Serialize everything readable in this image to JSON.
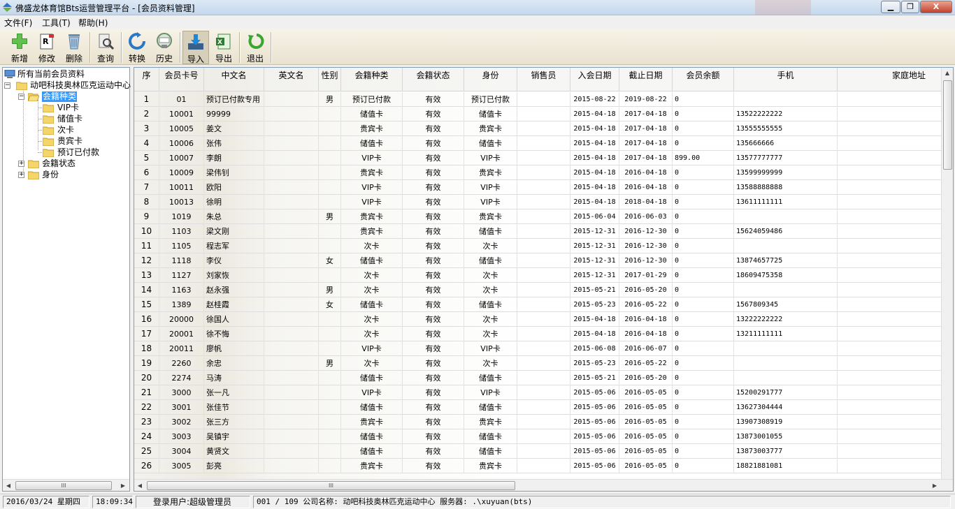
{
  "window": {
    "title": "佛盛龙体育馆Bts运营管理平台 - [会员资料管理]",
    "minimize": "▁",
    "restore": "❐",
    "close": "X"
  },
  "menu": [
    "文件(F)",
    "工具(T)",
    "帮助(H)"
  ],
  "toolbar": [
    {
      "label": "新增",
      "icon": "add-icon"
    },
    {
      "label": "修改",
      "icon": "edit-icon"
    },
    {
      "label": "删除",
      "icon": "delete-icon"
    },
    {
      "label": "查询",
      "icon": "search-icon"
    },
    {
      "label": "转换",
      "icon": "convert-icon"
    },
    {
      "label": "历史",
      "icon": "history-icon"
    },
    {
      "label": "导入",
      "icon": "import-icon"
    },
    {
      "label": "导出",
      "icon": "export-icon"
    },
    {
      "label": "退出",
      "icon": "exit-icon"
    }
  ],
  "tree": {
    "root": "所有当前会员资料",
    "company": "动吧科技奥林匹克运动中心",
    "category": "会籍种类",
    "cards": [
      "VIP卡",
      "储值卡",
      "次卡",
      "贵宾卡",
      "预订已付款"
    ],
    "status": "会籍状态",
    "identity": "身份"
  },
  "columns": [
    "序",
    "会员卡号",
    "中文名",
    "英文名",
    "性别",
    "会籍种类",
    "会籍状态",
    "身份",
    "销售员",
    "入会日期",
    "截止日期",
    "会员余额",
    "手机",
    "家庭地址"
  ],
  "rows": [
    [
      "1",
      "01",
      "预订已付款专用",
      "",
      "男",
      "预订已付款",
      "有效",
      "预订已付款",
      "",
      "2015-08-22",
      "2019-08-22",
      "0",
      ""
    ],
    [
      "2",
      "10001",
      "99999",
      "",
      "",
      "储值卡",
      "有效",
      "储值卡",
      "",
      "2015-04-18",
      "2017-04-18",
      "0",
      "13522222222"
    ],
    [
      "3",
      "10005",
      "姜文",
      "",
      "",
      "贵宾卡",
      "有效",
      "贵宾卡",
      "",
      "2015-04-18",
      "2017-04-18",
      "0",
      "13555555555"
    ],
    [
      "4",
      "10006",
      "张伟",
      "",
      "",
      "储值卡",
      "有效",
      "储值卡",
      "",
      "2015-04-18",
      "2017-04-18",
      "0",
      "135666666"
    ],
    [
      "5",
      "10007",
      "李朗",
      "",
      "",
      "VIP卡",
      "有效",
      "VIP卡",
      "",
      "2015-04-18",
      "2017-04-18",
      "899.00",
      "13577777777"
    ],
    [
      "6",
      "10009",
      "梁伟钊",
      "",
      "",
      "贵宾卡",
      "有效",
      "贵宾卡",
      "",
      "2015-04-18",
      "2016-04-18",
      "0",
      "13599999999"
    ],
    [
      "7",
      "10011",
      "欧阳",
      "",
      "",
      "VIP卡",
      "有效",
      "VIP卡",
      "",
      "2015-04-18",
      "2016-04-18",
      "0",
      "13588888888"
    ],
    [
      "8",
      "10013",
      "徐明",
      "",
      "",
      "VIP卡",
      "有效",
      "VIP卡",
      "",
      "2015-04-18",
      "2018-04-18",
      "0",
      "13611111111"
    ],
    [
      "9",
      "1019",
      "朱总",
      "",
      "男",
      "贵宾卡",
      "有效",
      "贵宾卡",
      "",
      "2015-06-04",
      "2016-06-03",
      "0",
      ""
    ],
    [
      "10",
      "1103",
      "梁文刚",
      "",
      "",
      "贵宾卡",
      "有效",
      "储值卡",
      "",
      "2015-12-31",
      "2016-12-30",
      "0",
      "15624059486"
    ],
    [
      "11",
      "1105",
      "程志军",
      "",
      "",
      "次卡",
      "有效",
      "次卡",
      "",
      "2015-12-31",
      "2016-12-30",
      "0",
      ""
    ],
    [
      "12",
      "1118",
      "李仪",
      "",
      "女",
      "储值卡",
      "有效",
      "储值卡",
      "",
      "2015-12-31",
      "2016-12-30",
      "0",
      "13874657725"
    ],
    [
      "13",
      "1127",
      "刘家恢",
      "",
      "",
      "次卡",
      "有效",
      "次卡",
      "",
      "2015-12-31",
      "2017-01-29",
      "0",
      "18609475358"
    ],
    [
      "14",
      "1163",
      "赵永强",
      "",
      "男",
      "次卡",
      "有效",
      "次卡",
      "",
      "2015-05-21",
      "2016-05-20",
      "0",
      ""
    ],
    [
      "15",
      "1389",
      "赵桂霞",
      "",
      "女",
      "储值卡",
      "有效",
      "储值卡",
      "",
      "2015-05-23",
      "2016-05-22",
      "0",
      "1567809345"
    ],
    [
      "16",
      "20000",
      "徐国人",
      "",
      "",
      "次卡",
      "有效",
      "次卡",
      "",
      "2015-04-18",
      "2016-04-18",
      "0",
      "13222222222"
    ],
    [
      "17",
      "20001",
      "徐不悔",
      "",
      "",
      "次卡",
      "有效",
      "次卡",
      "",
      "2015-04-18",
      "2016-04-18",
      "0",
      "13211111111"
    ],
    [
      "18",
      "20011",
      "廖帆",
      "",
      "",
      "VIP卡",
      "有效",
      "VIP卡",
      "",
      "2015-06-08",
      "2016-06-07",
      "0",
      ""
    ],
    [
      "19",
      "2260",
      "余忠",
      "",
      "男",
      "次卡",
      "有效",
      "次卡",
      "",
      "2015-05-23",
      "2016-05-22",
      "0",
      ""
    ],
    [
      "20",
      "2274",
      "马涛",
      "",
      "",
      "储值卡",
      "有效",
      "储值卡",
      "",
      "2015-05-21",
      "2016-05-20",
      "0",
      ""
    ],
    [
      "21",
      "3000",
      "张一凡",
      "",
      "",
      "VIP卡",
      "有效",
      "VIP卡",
      "",
      "2015-05-06",
      "2016-05-05",
      "0",
      "15200291777"
    ],
    [
      "22",
      "3001",
      "张佳节",
      "",
      "",
      "储值卡",
      "有效",
      "储值卡",
      "",
      "2015-05-06",
      "2016-05-05",
      "0",
      "13627304444"
    ],
    [
      "23",
      "3002",
      "张三方",
      "",
      "",
      "贵宾卡",
      "有效",
      "贵宾卡",
      "",
      "2015-05-06",
      "2016-05-05",
      "0",
      "13907308919"
    ],
    [
      "24",
      "3003",
      "吴镇宇",
      "",
      "",
      "储值卡",
      "有效",
      "储值卡",
      "",
      "2015-05-06",
      "2016-05-05",
      "0",
      "13873001055"
    ],
    [
      "25",
      "3004",
      "黄贤文",
      "",
      "",
      "储值卡",
      "有效",
      "储值卡",
      "",
      "2015-05-06",
      "2016-05-05",
      "0",
      "13873003777"
    ],
    [
      "26",
      "3005",
      "彭亮",
      "",
      "",
      "贵宾卡",
      "有效",
      "贵宾卡",
      "",
      "2015-05-06",
      "2016-05-05",
      "0",
      "18821881081"
    ]
  ],
  "status": {
    "date": "2016/03/24 星期四",
    "time": "18:09:34",
    "user": "登录用户:超级管理员",
    "info": "001 / 109 公司名称: 动吧科技奥林匹克运动中心 服务器: .\\xuyuan(bts)"
  },
  "colors": {
    "selection": "#3399ff",
    "folder": "#f5d56a",
    "title_bar": "#c4d7ec"
  }
}
